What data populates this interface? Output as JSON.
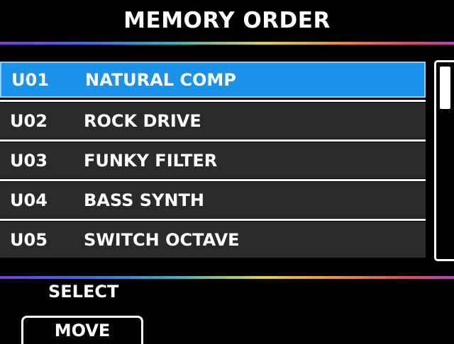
{
  "header": {
    "title": "MEMORY ORDER"
  },
  "memory_list": {
    "selected_index": 0,
    "items": [
      {
        "number": "U01",
        "name": "NATURAL COMP"
      },
      {
        "number": "U02",
        "name": "ROCK DRIVE"
      },
      {
        "number": "U03",
        "name": "FUNKY FILTER"
      },
      {
        "number": "U04",
        "name": "BASS SYNTH"
      },
      {
        "number": "U05",
        "name": "SWITCH OCTAVE"
      }
    ]
  },
  "footer": {
    "select_label": "SELECT",
    "move_label": "MOVE"
  },
  "colors": {
    "background": "#000000",
    "row_background": "#2a2a2a",
    "selected_row": "#1b92ea",
    "text": "#ffffff"
  }
}
